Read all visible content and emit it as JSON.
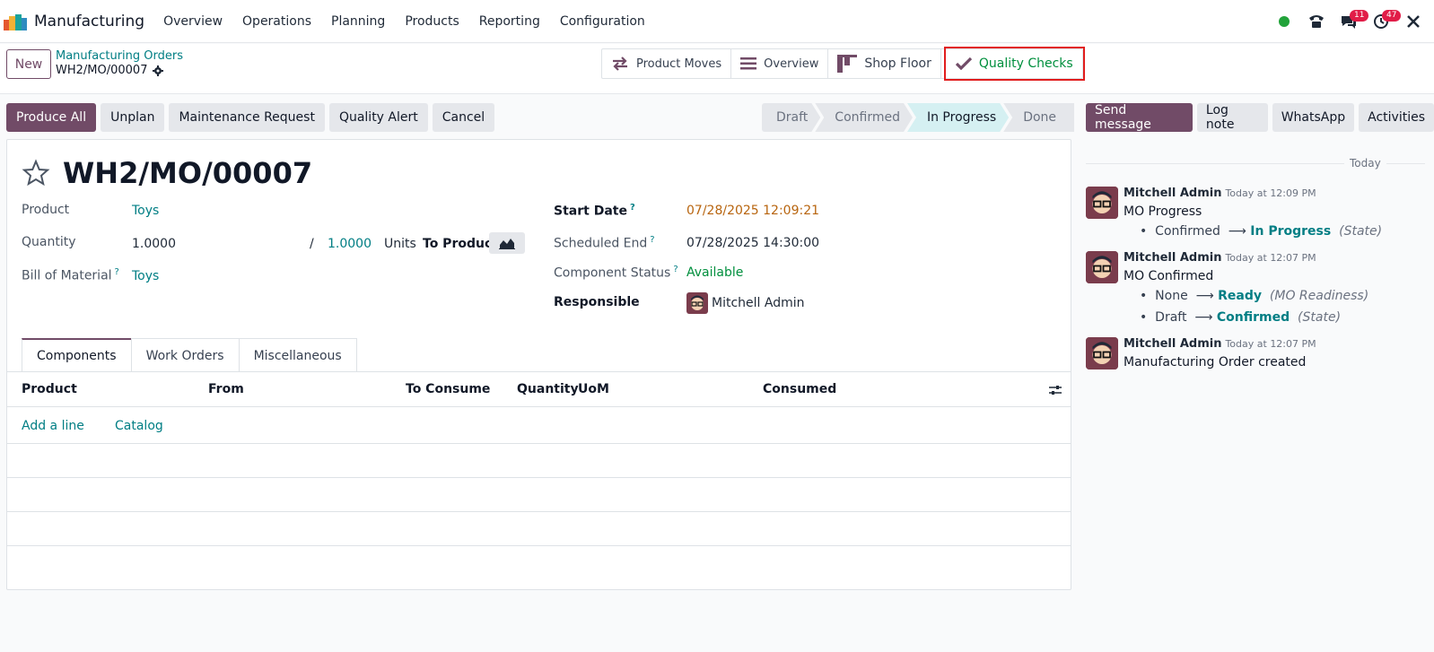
{
  "app": {
    "name": "Manufacturing"
  },
  "menu": [
    "Overview",
    "Operations",
    "Planning",
    "Products",
    "Reporting",
    "Configuration"
  ],
  "systray": {
    "chat_badge": "11",
    "activity_badge": "47"
  },
  "control_panel": {
    "new_label": "New",
    "breadcrumb_parent": "Manufacturing Orders",
    "breadcrumb_current": "WH2/MO/00007",
    "smart_buttons": {
      "product_moves": "Product Moves",
      "overview": "Overview",
      "shop_floor": "Shop Floor",
      "quality_checks": "Quality Checks"
    }
  },
  "actions": {
    "produce_all": "Produce All",
    "unplan": "Unplan",
    "maintenance_request": "Maintenance Request",
    "quality_alert": "Quality Alert",
    "cancel": "Cancel"
  },
  "statusbar": {
    "draft": "Draft",
    "confirmed": "Confirmed",
    "in_progress": "In Progress",
    "done": "Done",
    "active": "In Progress"
  },
  "form": {
    "title": "WH2/MO/00007",
    "product_label": "Product",
    "product_value": "Toys",
    "quantity_label": "Quantity",
    "quantity_value": "1.0000",
    "quantity_sep": "/",
    "quantity_produced": "1.0000",
    "units_label": "Units",
    "to_produce_label": "To Produce",
    "bom_label": "Bill of Material",
    "bom_value": "Toys",
    "start_date_label": "Start Date",
    "start_date_value": "07/28/2025 12:09:21",
    "scheduled_end_label": "Scheduled End",
    "scheduled_end_value": "07/28/2025 14:30:00",
    "component_status_label": "Component Status",
    "component_status_value": "Available",
    "responsible_label": "Responsible",
    "responsible_value": "Mitchell Admin",
    "help_mark": "?"
  },
  "tabs": {
    "components": "Components",
    "work_orders": "Work Orders",
    "miscellaneous": "Miscellaneous"
  },
  "table": {
    "headers": {
      "product": "Product",
      "from": "From",
      "to_consume": "To Consume",
      "quantity": "Quantity",
      "uom": "UoM",
      "consumed": "Consumed"
    },
    "add_line": "Add a line",
    "catalog": "Catalog"
  },
  "chatter": {
    "send_message": "Send message",
    "log_note": "Log note",
    "whatsapp": "WhatsApp",
    "activities": "Activities",
    "today": "Today",
    "messages": [
      {
        "author": "Mitchell Admin",
        "time": "Today at 12:09 PM",
        "body": "MO Progress",
        "tracking": [
          {
            "old": "Confirmed",
            "new": "In Progress",
            "field": "(State)"
          }
        ]
      },
      {
        "author": "Mitchell Admin",
        "time": "Today at 12:07 PM",
        "body": "MO Confirmed",
        "tracking": [
          {
            "old": "None",
            "new": "Ready",
            "field": "(MO Readiness)"
          },
          {
            "old": "Draft",
            "new": "Confirmed",
            "field": "(State)"
          }
        ]
      },
      {
        "author": "Mitchell Admin",
        "time": "Today at 12:07 PM",
        "body": "Manufacturing Order created",
        "tracking": []
      }
    ]
  },
  "colors": {
    "brand": "#714b67",
    "link": "#017e84",
    "success": "#008f3d",
    "warning_date": "#b8650f",
    "highlight": "#e11d1d",
    "badge": "#e11d48"
  }
}
